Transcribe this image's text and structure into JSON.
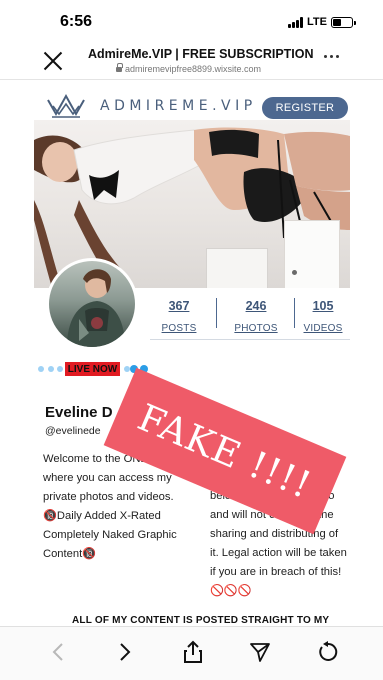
{
  "status_bar": {
    "time": "6:56",
    "network": "LTE",
    "battery_level": 0.45
  },
  "browser": {
    "title": "AdmireMe.VIP | FREE SUBSCRIPTION",
    "url": "admiremevipfree8899.wixsite.com",
    "close_icon": "close-icon",
    "more_icon": "more-horizontal-icon"
  },
  "site": {
    "logo_text": "ADMIREME.VIP",
    "logo_icon": "crown-icon",
    "register_label": "REGISTER",
    "accent_color": "#4d6890"
  },
  "stats": [
    {
      "value": "367",
      "label": "POSTS"
    },
    {
      "value": "246",
      "label": "PHOTOS"
    },
    {
      "value": "105",
      "label": "VIDEOS"
    }
  ],
  "live_badge": "LIVE NOW",
  "profile": {
    "name": "Eveline D",
    "handle": "@evelinede",
    "bio_left": [
      "Welcome to the ONLY p",
      "where you can access my",
      "private photos and videos.",
      "🔞Daily Added X-Rated",
      "Completely Naked Graphic",
      "Content🔞"
    ],
    "bio_right": [
      "belongs t",
      "and will not consent",
      "sharing and distributing of",
      "it. Legal action will be taken",
      "if you are in breach of this!",
      "🚫🚫🚫"
    ],
    "bio_right_tail": [
      "do",
      "the"
    ],
    "posted_heading": "ALL OF MY CONTENT IS POSTED STRAIGHT TO MY"
  },
  "overlay": {
    "stamp_text": "FAKE !!!!",
    "stamp_color": "#ef5b68"
  },
  "toolbar": {
    "back_icon": "back-arrow-icon",
    "forward_icon": "forward-arrow-icon",
    "share_icon": "share-icon",
    "send_icon": "send-icon",
    "reload_icon": "reload-icon"
  }
}
